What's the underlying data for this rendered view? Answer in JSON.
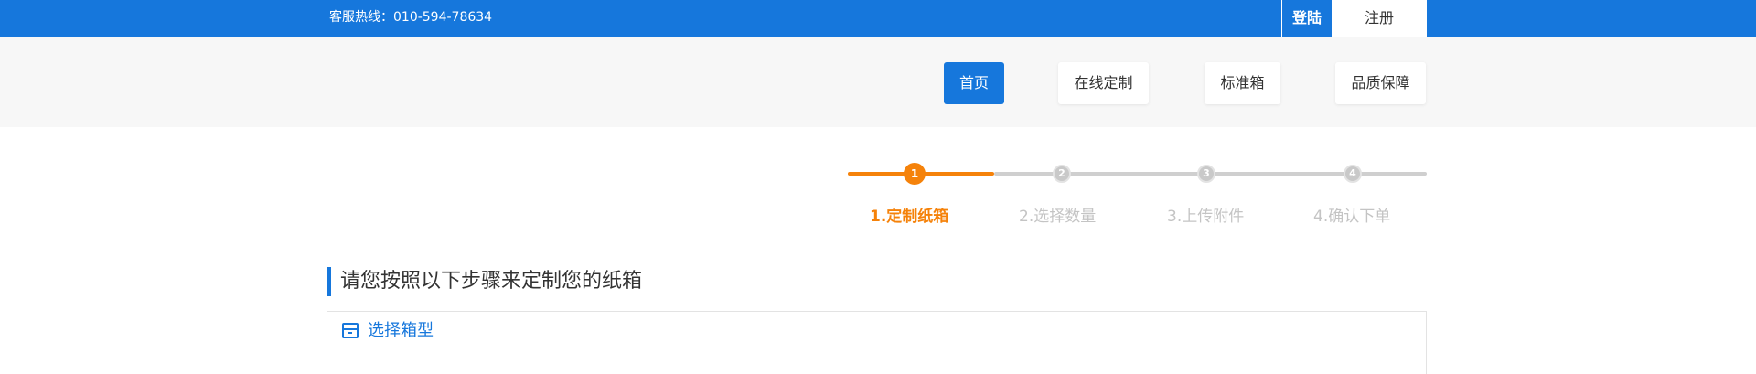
{
  "header": {
    "hotline": "客服热线：010-594-78634",
    "login_label": "登陆",
    "register_label": "注册"
  },
  "nav": {
    "items": [
      {
        "label": "首页",
        "active": true
      },
      {
        "label": "在线定制",
        "active": false
      },
      {
        "label": "标准箱",
        "active": false
      },
      {
        "label": "品质保障",
        "active": false
      }
    ]
  },
  "steps": {
    "current": 1,
    "items": [
      {
        "number": "1",
        "label": "1.定制纸箱"
      },
      {
        "number": "2",
        "label": "2.选择数量"
      },
      {
        "number": "3",
        "label": "3.上传附件"
      },
      {
        "number": "4",
        "label": "4.确认下单"
      }
    ]
  },
  "main": {
    "section_title": "请您按照以下步骤来定制您的纸箱",
    "panel_title": "选择箱型",
    "panel_icon": "box-icon"
  },
  "colors": {
    "primary": "#1677dc",
    "accent": "#f5820a",
    "inactive": "#c9c9c9"
  }
}
